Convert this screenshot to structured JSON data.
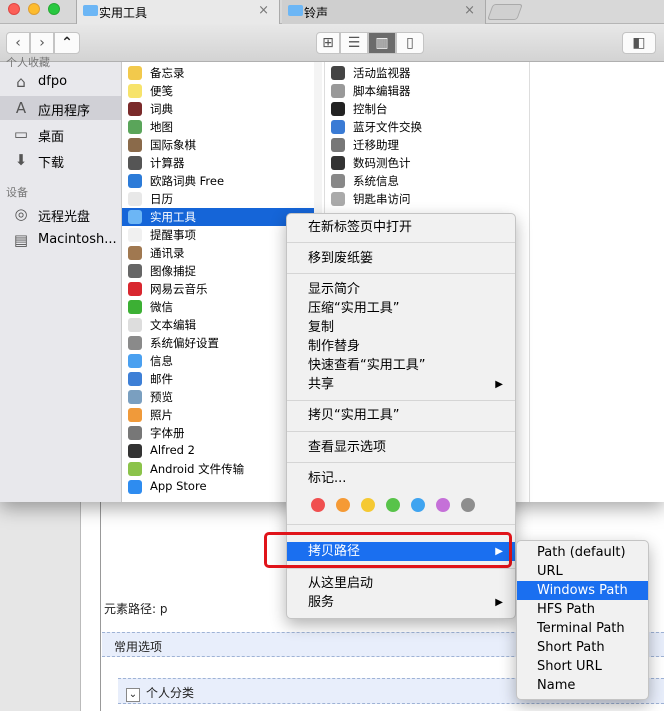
{
  "background": {
    "element_path": "元素路径: p",
    "common_options": "常用选项",
    "personal_category": "个人分类"
  },
  "tabs": [
    {
      "label": "实用工具"
    },
    {
      "label": "铃声"
    }
  ],
  "sidebar": {
    "favorites_heading": "个人收藏",
    "devices_heading": "设备",
    "items": [
      {
        "label": "dfpo",
        "icon": "home-icon"
      },
      {
        "label": "应用程序",
        "icon": "applications-icon"
      },
      {
        "label": "桌面",
        "icon": "desktop-icon"
      },
      {
        "label": "下载",
        "icon": "download-icon"
      },
      {
        "label": "远程光盘",
        "icon": "disc-icon"
      },
      {
        "label": "Macintosh...",
        "icon": "harddisk-icon"
      }
    ]
  },
  "column1": [
    {
      "label": "备忘录",
      "color": "#f2c94c"
    },
    {
      "label": "便笺",
      "color": "#f7e36b"
    },
    {
      "label": "词典",
      "color": "#7a2a2a"
    },
    {
      "label": "地图",
      "color": "#5aa55a"
    },
    {
      "label": "国际象棋",
      "color": "#8a6a4a"
    },
    {
      "label": "计算器",
      "color": "#555555"
    },
    {
      "label": "欧路词典 Free",
      "color": "#2c7bd8"
    },
    {
      "label": "日历",
      "color": "#e8e8e8"
    },
    {
      "label": "实用工具",
      "color": "#6cb6f5"
    },
    {
      "label": "提醒事项",
      "color": "#f0f0f0"
    },
    {
      "label": "通讯录",
      "color": "#a07850"
    },
    {
      "label": "图像捕捉",
      "color": "#666666"
    },
    {
      "label": "网易云音乐",
      "color": "#d8272f"
    },
    {
      "label": "微信",
      "color": "#3cb034"
    },
    {
      "label": "文本编辑",
      "color": "#dddddd"
    },
    {
      "label": "系统偏好设置",
      "color": "#8a8a8a"
    },
    {
      "label": "信息",
      "color": "#4aa0f0"
    },
    {
      "label": "邮件",
      "color": "#3d7fd6"
    },
    {
      "label": "预览",
      "color": "#7a9fc0"
    },
    {
      "label": "照片",
      "color": "#f09a3a"
    },
    {
      "label": "字体册",
      "color": "#777777"
    },
    {
      "label": "Alfred 2",
      "color": "#333333"
    },
    {
      "label": "Android 文件传输",
      "color": "#8bc34a"
    },
    {
      "label": "App Store",
      "color": "#2e8cf0"
    }
  ],
  "column2": [
    {
      "label": "活动监视器",
      "color": "#444444"
    },
    {
      "label": "脚本编辑器",
      "color": "#999999"
    },
    {
      "label": "控制台",
      "color": "#222222"
    },
    {
      "label": "蓝牙文件交换",
      "color": "#3a7bd5"
    },
    {
      "label": "迁移助理",
      "color": "#777777"
    },
    {
      "label": "数码测色计",
      "color": "#333333"
    },
    {
      "label": "系统信息",
      "color": "#888888"
    },
    {
      "label": "钥匙串访问",
      "color": "#aaaaaa"
    }
  ],
  "context_menu": {
    "open_new_tab": "在新标签页中打开",
    "move_trash": "移到废纸篓",
    "get_info": "显示简介",
    "compress": "压缩“实用工具”",
    "duplicate": "复制",
    "make_alias": "制作替身",
    "quick_look": "快速查看“实用工具”",
    "share": "共享",
    "copy_item": "拷贝“实用工具”",
    "view_options": "查看显示选项",
    "tags": "标记...",
    "tag_colors": [
      "#f05050",
      "#f59a35",
      "#f5c933",
      "#58c34a",
      "#3fa4f0",
      "#c570d8",
      "#8e8e8e"
    ],
    "copy_path": "拷贝路径",
    "open_here": "从这里启动",
    "services": "服务"
  },
  "submenu": [
    {
      "label": "Path (default)"
    },
    {
      "label": "URL"
    },
    {
      "label": "Windows Path"
    },
    {
      "label": "HFS Path"
    },
    {
      "label": "Terminal Path"
    },
    {
      "label": "Short Path"
    },
    {
      "label": "Short URL"
    },
    {
      "label": "Name"
    }
  ]
}
